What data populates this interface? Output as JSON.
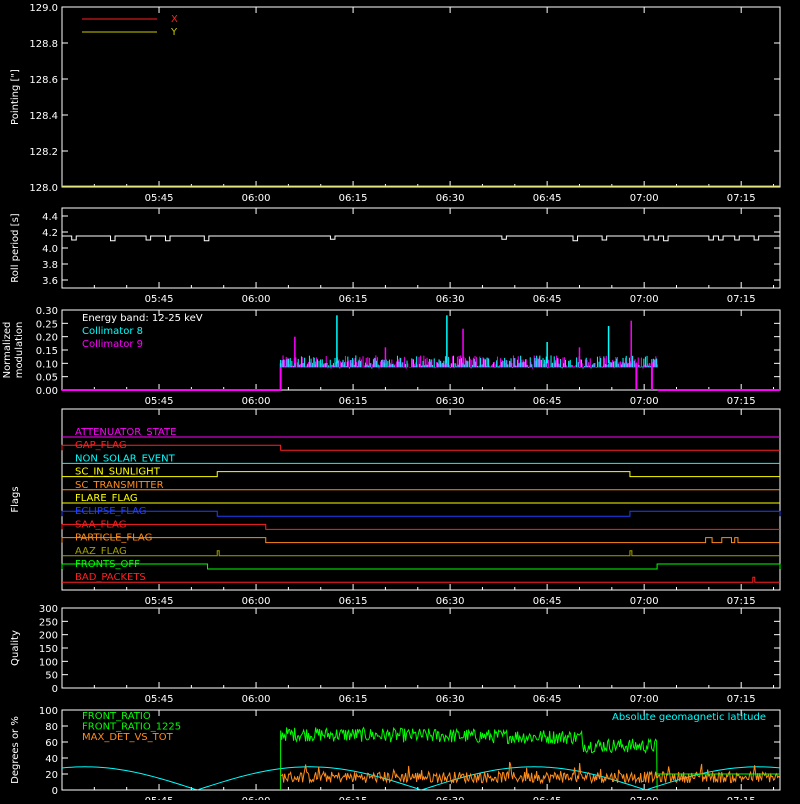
{
  "colors": {
    "axis": "#ffffff",
    "x": "#ff2020",
    "y": "#c8c800",
    "roll": "#ffffff",
    "coll8": "#00ffff",
    "coll9": "#ff00ff",
    "front_ratio": "#00ff00",
    "front_ratio_1225": "#00ff00",
    "max_det": "#ff8c1a",
    "geomag": "#00ffff"
  },
  "time_axis": {
    "tick_labels": [
      "05:45",
      "06:00",
      "06:15",
      "06:30",
      "06:45",
      "07:00",
      "07:15"
    ],
    "tick_minutes": [
      345,
      360,
      375,
      390,
      405,
      420,
      435
    ],
    "range_minutes": [
      330,
      441
    ]
  },
  "chart_data": [
    {
      "id": "pointing",
      "type": "line",
      "ylabel": "Pointing [\"]",
      "ylim": [
        128.0,
        129.0
      ],
      "yticks": [
        "128.0",
        "128.2",
        "128.4",
        "128.6",
        "128.8",
        "129.0"
      ],
      "yvals": [
        128.0,
        128.2,
        128.4,
        128.6,
        128.8,
        129.0
      ],
      "legend": [
        {
          "name": "X",
          "colorKey": "x"
        },
        {
          "name": "Y",
          "colorKey": "y"
        }
      ],
      "series": [
        {
          "name": "Y",
          "colorKey": "y",
          "x": [
            330,
            441
          ],
          "y": [
            128.0,
            128.0
          ]
        }
      ]
    },
    {
      "id": "roll",
      "type": "line",
      "ylabel": "Roll period [s]",
      "ylim": [
        3.5,
        4.5
      ],
      "yticks": [
        "3.6",
        "3.8",
        "4.0",
        "4.2",
        "4.4"
      ],
      "yvals": [
        3.6,
        3.8,
        4.0,
        4.2,
        4.4
      ],
      "base": 4.15,
      "dips": [
        [
          331.5,
          4.1
        ],
        [
          337.5,
          4.09
        ],
        [
          343,
          4.1
        ],
        [
          346,
          4.09
        ],
        [
          352,
          4.09
        ],
        [
          371.5,
          4.11
        ],
        [
          398,
          4.11
        ],
        [
          409,
          4.09
        ],
        [
          413.5,
          4.1
        ],
        [
          420,
          4.1
        ],
        [
          421.5,
          4.1
        ],
        [
          423,
          4.09
        ],
        [
          430,
          4.1
        ],
        [
          431.5,
          4.1
        ],
        [
          434,
          4.1
        ],
        [
          437,
          4.1
        ]
      ]
    },
    {
      "id": "modulation",
      "type": "bar",
      "ylabel": "Normalized modulation",
      "ylim": [
        0.0,
        0.3
      ],
      "yticks": [
        "0.00",
        "0.05",
        "0.10",
        "0.15",
        "0.20",
        "0.25",
        "0.30"
      ],
      "yvals": [
        0.0,
        0.05,
        0.1,
        0.15,
        0.2,
        0.25,
        0.3
      ],
      "annotation": "Energy band: 12-25 keV",
      "legend": [
        {
          "name": "Collimator 8",
          "colorKey": "coll8"
        },
        {
          "name": "Collimator 9",
          "colorKey": "coll9"
        }
      ],
      "data_start": 363.8,
      "data_end": 422.0,
      "spikes": [
        [
          366,
          0.2
        ],
        [
          372.5,
          0.28
        ],
        [
          380,
          0.16
        ],
        [
          389.5,
          0.28
        ],
        [
          392,
          0.23
        ],
        [
          405,
          0.18
        ],
        [
          410,
          0.16
        ],
        [
          414.5,
          0.24
        ],
        [
          418,
          0.26
        ]
      ]
    },
    {
      "id": "flags",
      "type": "table",
      "ylabel": "Flags",
      "series": [
        {
          "name": "ATTENUATOR_STATE",
          "color": "#ff00ff",
          "high": []
        },
        {
          "name": "SAA_FLAG_2",
          "label": "GAP_FLAG",
          "color": "#ff2020",
          "high": [
            [
              330,
              363.8
            ]
          ]
        },
        {
          "name": "NON_SOLAR_EVENT",
          "color": "#00ffff",
          "high": []
        },
        {
          "name": "SC_IN_SUNLIGHT",
          "color": "#ffff00",
          "high": [
            [
              354,
              417.8
            ]
          ]
        },
        {
          "name": "SC_TRANSMITTER",
          "color": "#ff8c1a",
          "high": []
        },
        {
          "name": "FLARE_FLAG",
          "color": "#ffff00",
          "high": []
        },
        {
          "name": "ECLIPSE_FLAG",
          "color": "#2040ff",
          "high": [
            [
              330,
              354
            ],
            [
              417.8,
              441
            ]
          ]
        },
        {
          "name": "SAA_FLAG",
          "color": "#ff2020",
          "high": [
            [
              330,
              361.5
            ]
          ]
        },
        {
          "name": "PARTICLE_FLAG",
          "color": "#ff8c1a",
          "high": [
            [
              330,
              361.5
            ],
            [
              429.5,
              430.5
            ],
            [
              432,
              433.5
            ],
            [
              434,
              434.5
            ]
          ]
        },
        {
          "name": "AAZ_FLAG",
          "color": "#a0a000",
          "high": [
            [
              354,
              354.3
            ],
            [
              417.8,
              418.1
            ]
          ]
        },
        {
          "name": "FRONTS_OFF",
          "color": "#00ff00",
          "high": [
            [
              330,
              352.5
            ],
            [
              422,
              441
            ]
          ]
        },
        {
          "name": "BAD_PACKETS",
          "color": "#ff2020",
          "high": [
            [
              436.8,
              437.1
            ]
          ]
        }
      ]
    },
    {
      "id": "quality",
      "type": "line",
      "ylabel": "Quality",
      "ylim": [
        0,
        300
      ],
      "yticks": [
        "0",
        "50",
        "100",
        "150",
        "200",
        "250",
        "300"
      ],
      "yvals": [
        0,
        50,
        100,
        150,
        200,
        250,
        300
      ],
      "series": []
    },
    {
      "id": "ratios",
      "type": "line",
      "ylabel": "Degrees or %",
      "ylim": [
        0,
        100
      ],
      "yticks": [
        "0",
        "20",
        "40",
        "60",
        "80",
        "100"
      ],
      "yvals": [
        0,
        20,
        40,
        60,
        80,
        100
      ],
      "legend": [
        {
          "name": "FRONT_RATIO",
          "colorKey": "front_ratio"
        },
        {
          "name": "FRONT_RATIO_1225",
          "colorKey": "front_ratio_1225"
        },
        {
          "name": "MAX_DET_VS_TOT",
          "colorKey": "max_det"
        }
      ],
      "annotation_right": "Absolute geomagnetic latitude",
      "front_start": 363.8,
      "front_end": 422.0
    }
  ]
}
